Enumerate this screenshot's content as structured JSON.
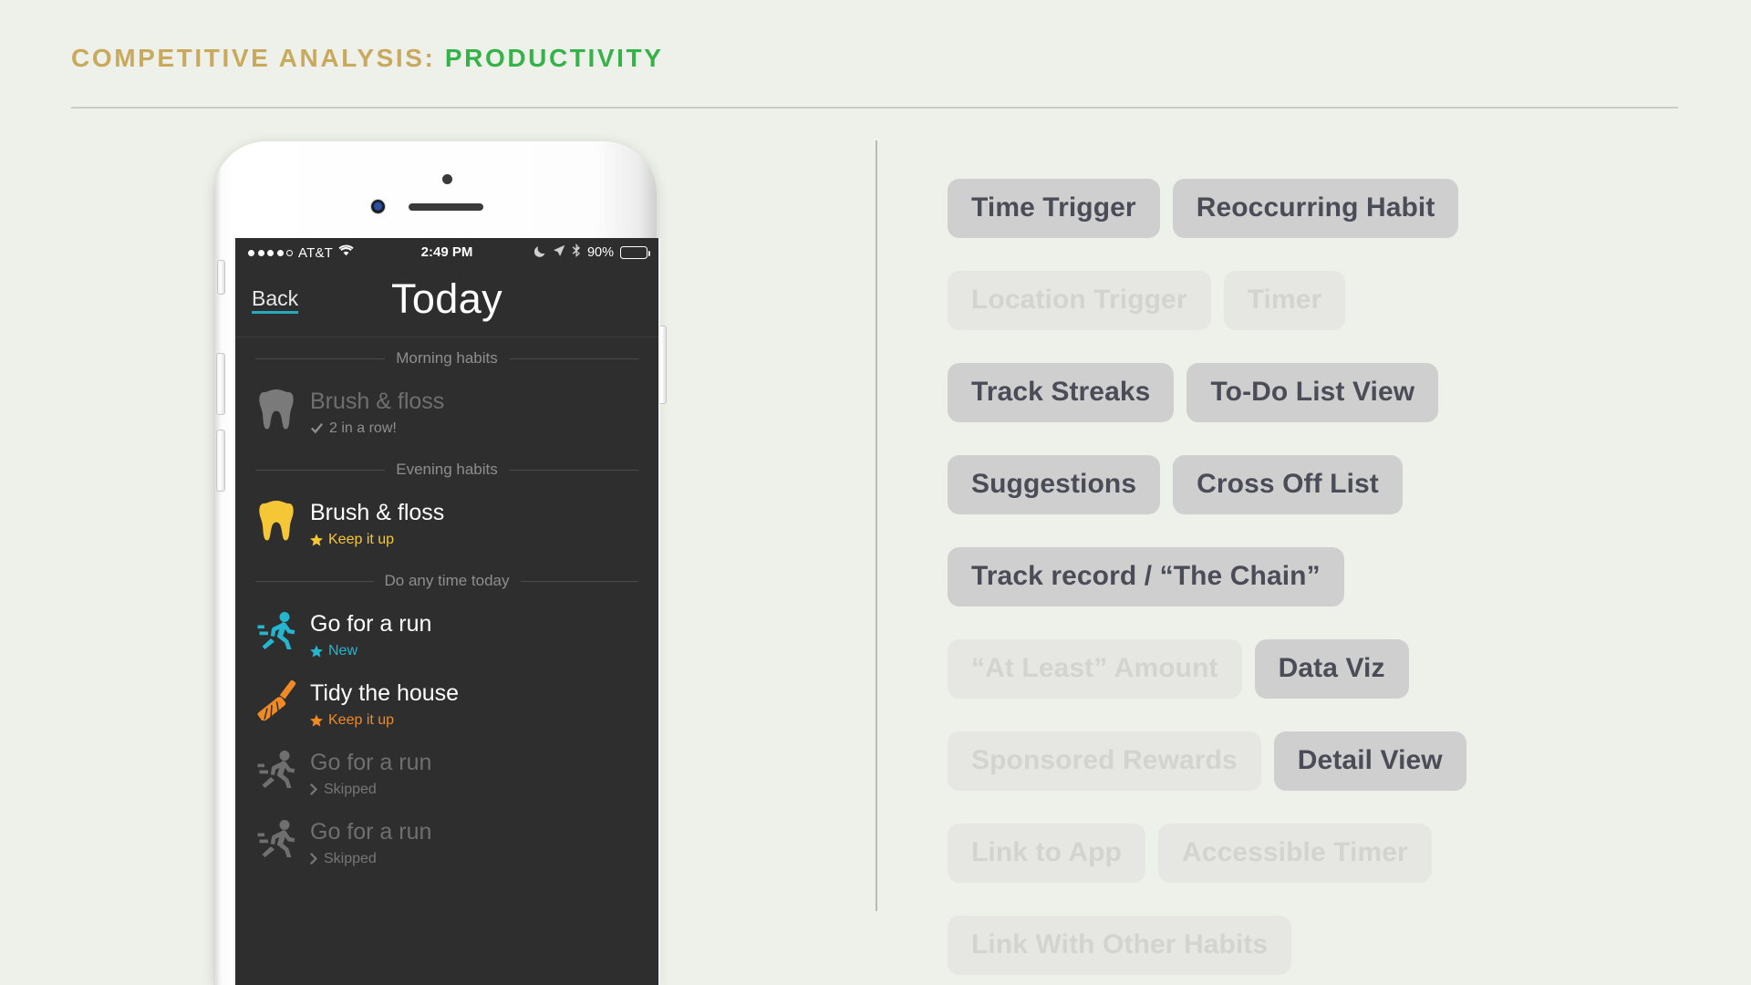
{
  "header": {
    "lead": "COMPETITIVE ANALYSIS:",
    "accent": "PRODUCTIVITY"
  },
  "phone": {
    "status_bar": {
      "carrier": "AT&T",
      "time": "2:49 PM",
      "battery_percent": "90%",
      "icons": [
        "signal-dots-icon",
        "wifi-icon",
        "moon-icon",
        "location-arrow-icon",
        "bluetooth-icon",
        "battery-icon"
      ]
    },
    "nav": {
      "back_label": "Back",
      "title": "Today"
    },
    "sections": [
      {
        "label": "Morning habits",
        "items": [
          {
            "icon": "tooth-icon",
            "icon_color": "#7a7a7a",
            "title": "Brush & floss",
            "status_glyph": "check-icon",
            "status_text": "2 in a row!",
            "status_color": "#8e8e8e",
            "state": "completed-dim"
          }
        ]
      },
      {
        "label": "Evening habits",
        "items": [
          {
            "icon": "tooth-icon",
            "icon_color": "#f5c736",
            "title": "Brush & floss",
            "status_glyph": "star-icon",
            "status_text": "Keep it up",
            "status_color": "#f5c736",
            "state": "active"
          }
        ]
      },
      {
        "label": "Do any time today",
        "items": [
          {
            "icon": "runner-icon",
            "icon_color": "#25b6cf",
            "title": "Go for a run",
            "status_glyph": "star-icon",
            "status_text": "New",
            "status_color": "#25b6cf",
            "state": "active"
          },
          {
            "icon": "broom-icon",
            "icon_color": "#ef8a24",
            "title": "Tidy the house",
            "status_glyph": "star-icon",
            "status_text": "Keep it up",
            "status_color": "#ef8a24",
            "state": "active"
          },
          {
            "icon": "runner-icon",
            "icon_color": "#6f6f6f",
            "title": "Go for a run",
            "status_glyph": "chevron-right-icon",
            "status_text": "Skipped",
            "status_color": "#767676",
            "state": "skipped-dim"
          },
          {
            "icon": "runner-icon",
            "icon_color": "#6f6f6f",
            "title": "Go for a run",
            "status_glyph": "chevron-right-icon",
            "status_text": "Skipped",
            "status_color": "#767676",
            "state": "skipped-dim"
          }
        ]
      }
    ]
  },
  "features": {
    "rows": [
      [
        {
          "label": "Time Trigger",
          "state": "on"
        },
        {
          "label": "Reoccurring Habit",
          "state": "on"
        }
      ],
      [
        {
          "label": "Location Trigger",
          "state": "off"
        },
        {
          "label": "Timer",
          "state": "off"
        }
      ],
      [
        {
          "label": "Track Streaks",
          "state": "on"
        },
        {
          "label": "To-Do List View",
          "state": "on"
        }
      ],
      [
        {
          "label": "Suggestions",
          "state": "on"
        },
        {
          "label": "Cross Off List",
          "state": "on"
        }
      ],
      [
        {
          "label": "Track record / “The Chain”",
          "state": "on"
        }
      ],
      [
        {
          "label": "“At Least” Amount",
          "state": "off"
        },
        {
          "label": "Data Viz",
          "state": "on"
        }
      ],
      [
        {
          "label": "Sponsored Rewards",
          "state": "off"
        },
        {
          "label": "Detail View",
          "state": "on"
        }
      ],
      [
        {
          "label": "Link to App",
          "state": "off"
        },
        {
          "label": "Accessible Timer",
          "state": "off"
        }
      ],
      [
        {
          "label": "Link With Other Habits",
          "state": "off"
        }
      ]
    ]
  },
  "colors": {
    "page_background": "#eef0ea",
    "gold": "#c8a95e",
    "green": "#35b34a",
    "teal": "#2aa9bd",
    "screen_background": "#2e2e2e",
    "tag_on_bg": "#cfcfcf",
    "tag_on_text": "#4a4d57",
    "tag_off_bg": "#e6e7e2",
    "tag_off_text": "#d3d4cf"
  }
}
